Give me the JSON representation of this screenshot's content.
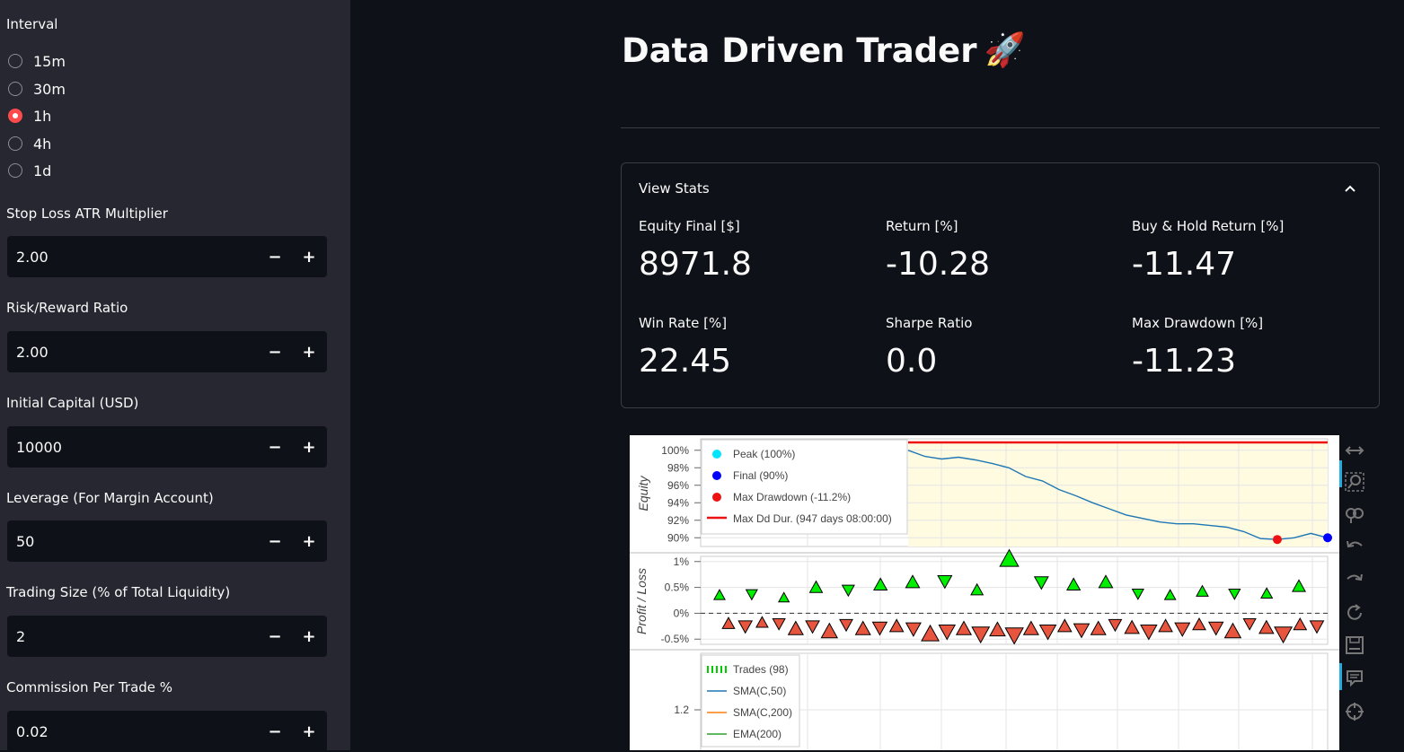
{
  "sidebar": {
    "interval_label": "Interval",
    "intervals": [
      "15m",
      "30m",
      "1h",
      "4h",
      "1d"
    ],
    "selected_interval": "1h",
    "inputs": [
      {
        "label": "Stop Loss ATR Multiplier",
        "value": "2.00"
      },
      {
        "label": "Risk/Reward Ratio",
        "value": "2.00"
      },
      {
        "label": "Initial Capital (USD)",
        "value": "10000"
      },
      {
        "label": "Leverage (For Margin Account)",
        "value": "50"
      },
      {
        "label": "Trading Size (% of Total Liquidity)",
        "value": "2"
      },
      {
        "label": "Commission Per Trade %",
        "value": "0.02"
      }
    ],
    "minus_symbol": "−",
    "plus_symbol": "+"
  },
  "main": {
    "title": "Data Driven Trader",
    "title_emoji": "🚀",
    "stats": {
      "title": "View Stats",
      "metrics": [
        {
          "label": "Equity Final [$]",
          "value": "8971.8"
        },
        {
          "label": "Return [%]",
          "value": "-10.28"
        },
        {
          "label": "Buy & Hold Return [%]",
          "value": "-11.47"
        },
        {
          "label": "Win Rate [%]",
          "value": "22.45"
        },
        {
          "label": "Sharpe Ratio",
          "value": "0.0"
        },
        {
          "label": "Max Drawdown [%]",
          "value": "-11.23"
        }
      ]
    }
  },
  "plot": {
    "equity_ylabel": "Equity",
    "pl_ylabel": "Profit / Loss",
    "equity_ticks": [
      "100%",
      "98%",
      "96%",
      "94%",
      "92%",
      "90%"
    ],
    "pl_ticks": [
      "1%",
      "0.5%",
      "0%",
      "-0.5%"
    ],
    "price_ticks": [
      "1.2"
    ],
    "equity_legend": [
      "Peak (100%)",
      "Final (90%)",
      "Max Drawdown (-11.2%)",
      "Max Dd Dur. (947 days 08:00:00)"
    ],
    "price_legend": [
      "Trades (98)",
      "SMA(C,50)",
      "SMA(C,200)",
      "EMA(200)"
    ],
    "colors": {
      "peak": "#00e5ff",
      "final": "#0000ff",
      "max_drawdown": "#ee1111",
      "equity_line": "#1f77b4",
      "win": "#00ee00",
      "loss": "#e8553f",
      "sma50": "#1f77b4",
      "sma200": "#ff7f0e",
      "ema200": "#2ca02c",
      "dd_fill": "#fffbe0"
    },
    "toolbar_icons": [
      "pan-icon",
      "box-zoom-icon",
      "wheel-zoom-icon",
      "undo-icon",
      "redo-icon",
      "reset-icon",
      "save-icon",
      "hover-icon",
      "crosshair-icon"
    ]
  },
  "chart_data": [
    {
      "type": "line",
      "ylabel": "Equity",
      "ylim": [
        89,
        101
      ],
      "series": [
        {
          "name": "Equity",
          "values": [
            100.0,
            99.3,
            99.0,
            99.2,
            98.9,
            98.5,
            98.0,
            97.0,
            96.5,
            95.5,
            94.8,
            94.0,
            93.3,
            92.6,
            92.2,
            91.8,
            91.6,
            91.6,
            91.4,
            91.2,
            90.7,
            89.9,
            89.8,
            90.0,
            90.5,
            90.0
          ]
        }
      ]
    },
    {
      "type": "scatter",
      "ylabel": "Profit / Loss",
      "ylim": [
        -0.6,
        1.1
      ],
      "series": [
        {
          "name": "win",
          "values": [
            0.35,
            0.37,
            0.3,
            0.5,
            0.45,
            0.55,
            0.6,
            0.62,
            0.45,
            1.05,
            0.6,
            0.55,
            0.6,
            0.38,
            0.35,
            0.42,
            0.38,
            0.38,
            0.52
          ]
        },
        {
          "name": "loss",
          "values": [
            -0.2,
            -0.25,
            -0.18,
            -0.2,
            -0.3,
            -0.25,
            -0.35,
            -0.22,
            -0.3,
            -0.28,
            -0.25,
            -0.3,
            -0.4,
            -0.35,
            -0.3,
            -0.4,
            -0.32,
            -0.42,
            -0.3,
            -0.35,
            -0.25,
            -0.32,
            -0.3,
            -0.22,
            -0.28,
            -0.35,
            -0.25,
            -0.3,
            -0.22,
            -0.28,
            -0.35,
            -0.2,
            -0.28,
            -0.4,
            -0.22,
            -0.25
          ]
        }
      ]
    }
  ]
}
